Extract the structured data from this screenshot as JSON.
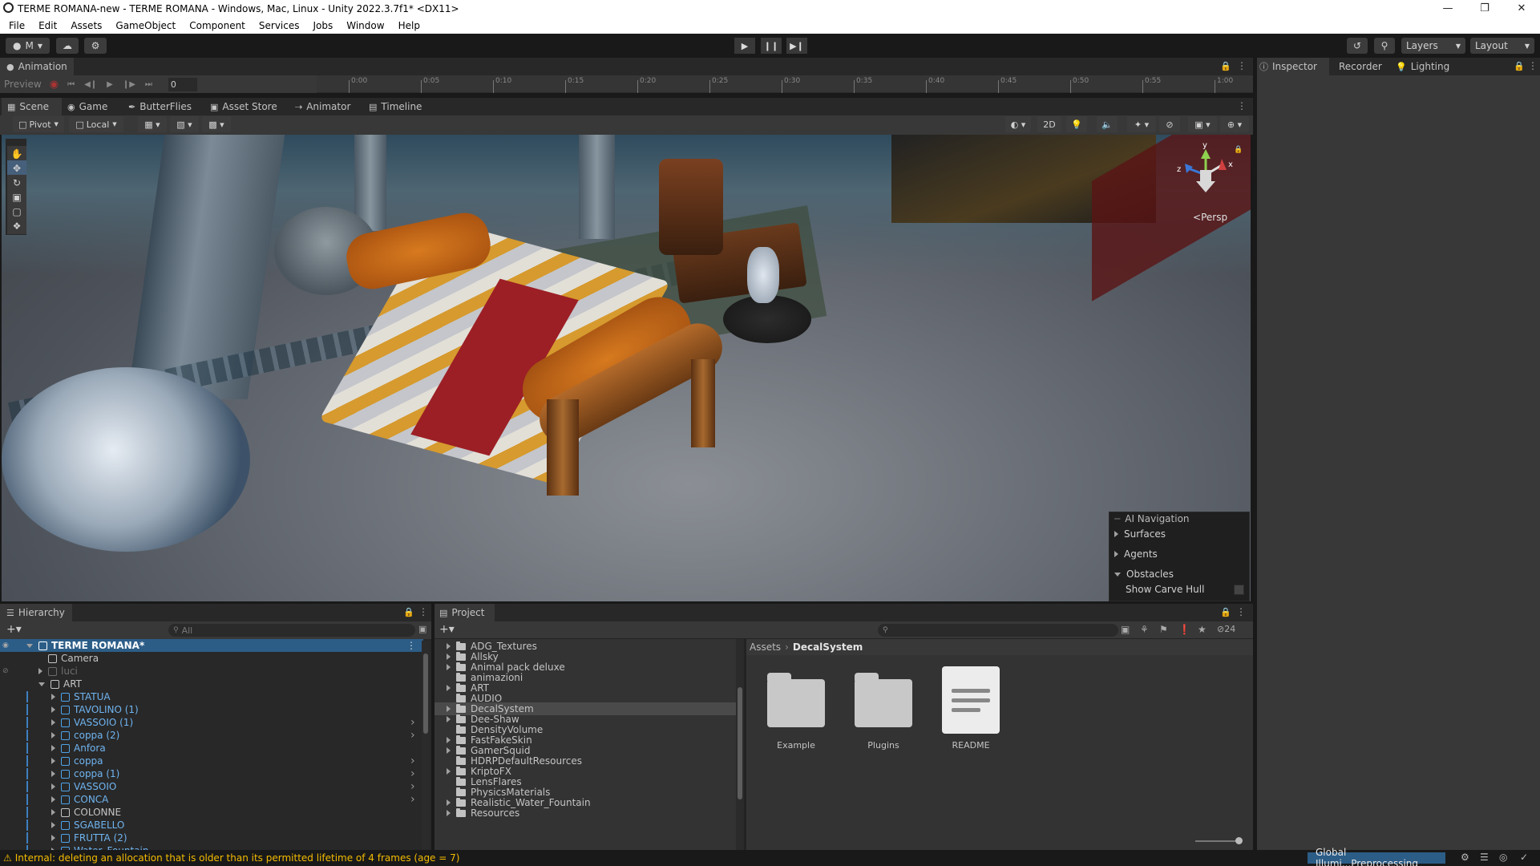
{
  "window": {
    "title": "TERME ROMANA-new - TERME ROMANA - Windows, Mac, Linux - Unity 2022.3.7f1* <DX11>"
  },
  "menu": [
    "File",
    "Edit",
    "Assets",
    "GameObject",
    "Component",
    "Services",
    "Jobs",
    "Window",
    "Help"
  ],
  "toolbar": {
    "account_label": "M",
    "layers_label": "Layers",
    "layout_label": "Layout"
  },
  "animation": {
    "tab_label": "Animation",
    "preview_label": "Preview",
    "frame_value": "0",
    "timeline_ticks": [
      "0:00",
      "0:05",
      "0:10",
      "0:15",
      "0:20",
      "0:25",
      "0:30",
      "0:35",
      "0:40",
      "0:45",
      "0:50",
      "0:55",
      "1:00"
    ]
  },
  "right_tabs": [
    "Inspector",
    "Recorder",
    "Lighting"
  ],
  "scene_tabs": [
    "Scene",
    "Game",
    "ButterFlies",
    "Asset Store",
    "Animator",
    "Timeline"
  ],
  "scene_toolbar": {
    "pivot_label": "Pivot",
    "local_label": "Local",
    "mode_2d": "2D"
  },
  "gizmo": {
    "y_label": "y",
    "x_label": "x",
    "z_label": "z",
    "projection_label": "Persp"
  },
  "ai_navigation": {
    "title": "AI Navigation",
    "items": [
      "Surfaces",
      "Agents",
      "Obstacles"
    ],
    "option_label": "Show Carve Hull"
  },
  "hierarchy": {
    "tab_label": "Hierarchy",
    "search_placeholder": "All",
    "rows": [
      {
        "label": "TERME ROMANA*"
      },
      {
        "label": "Camera"
      },
      {
        "label": "luci"
      },
      {
        "label": "ART"
      },
      {
        "label": "STATUA"
      },
      {
        "label": "TAVOLINO (1)"
      },
      {
        "label": "VASSOIO (1)"
      },
      {
        "label": "coppa (2)"
      },
      {
        "label": "Anfora"
      },
      {
        "label": "coppa"
      },
      {
        "label": "coppa (1)"
      },
      {
        "label": "VASSOIO"
      },
      {
        "label": "CONCA"
      },
      {
        "label": "COLONNE"
      },
      {
        "label": "SGABELLO"
      },
      {
        "label": "FRUTTA (2)"
      },
      {
        "label": "Water_Fountain"
      }
    ]
  },
  "project": {
    "tab_label": "Project",
    "breadcrumb_root": "Assets",
    "breadcrumb_current": "DecalSystem",
    "hidden_count": "24",
    "tree": [
      "ADG_Textures",
      "Allsky",
      "Animal pack deluxe",
      "animazioni",
      "ART",
      "AUDIO",
      "DecalSystem",
      "Dee-Shaw",
      "DensityVolume",
      "FastFakeSkin",
      "GamerSquid",
      "HDRPDefaultResources",
      "KriptoFX",
      "LensFlares",
      "PhysicsMaterials",
      "Realistic_Water_Fountain",
      "Resources"
    ],
    "items": [
      "Example",
      "Plugins",
      "README"
    ]
  },
  "statusbar": {
    "message": "Internal: deleting an allocation that is older than its permitted lifetime of 4 frames (age = 7)",
    "progress_label": "Global Illumi...Preprocessing"
  },
  "colors": {
    "accent_blue": "#2c5d87",
    "selected_text": "#ffffff",
    "prefab_blue": "#4fa3e8",
    "warning_yellow": "#f4bc02"
  }
}
